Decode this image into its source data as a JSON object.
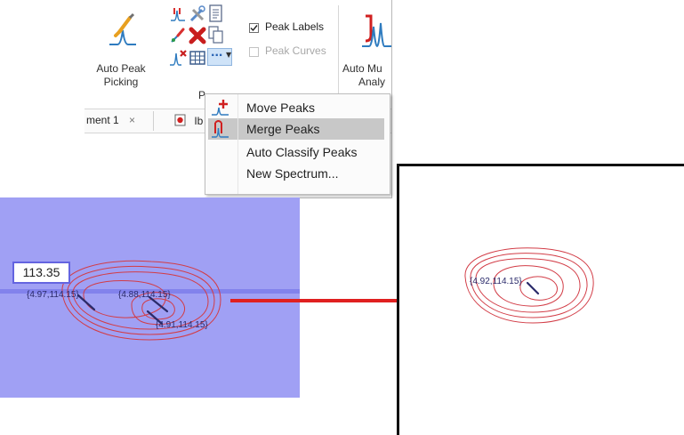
{
  "ribbon": {
    "auto_peak_picking_label_1": "Auto Peak",
    "auto_peak_picking_label_2": "Picking",
    "peak_labels_label": "Peak Labels",
    "peak_curves_label": "Peak Curves",
    "auto_multi_label_1": "Auto Mu",
    "auto_multi_label_2": "Analy",
    "group_label_partial": "P",
    "more_button_label": "..."
  },
  "tabs": {
    "document_tab_label": "ment 1",
    "document_tab_close": "×",
    "second_tab_label": "Ib"
  },
  "menu": {
    "items": [
      {
        "label": "Move Peaks",
        "icon": "move-peaks-icon"
      },
      {
        "label": "Merge Peaks",
        "icon": "merge-peaks-icon",
        "highlighted": true
      },
      {
        "label": "Auto Classify Peaks"
      },
      {
        "label": "New Spectrum..."
      }
    ]
  },
  "left_spectrum": {
    "cursor_value": "113.35",
    "peaks": [
      {
        "label": "{4.97,114.15}"
      },
      {
        "label": "{4.88,114.15}"
      },
      {
        "label": "{4.91,114.15}"
      }
    ]
  },
  "right_spectrum": {
    "peaks": [
      {
        "label": "{4.92,114.15}"
      }
    ]
  },
  "colors": {
    "selection_fill": "#a0a0f4",
    "contour_red": "#d23c46",
    "contour_dark": "#5a4a7a",
    "arrow_red": "#e02020"
  }
}
